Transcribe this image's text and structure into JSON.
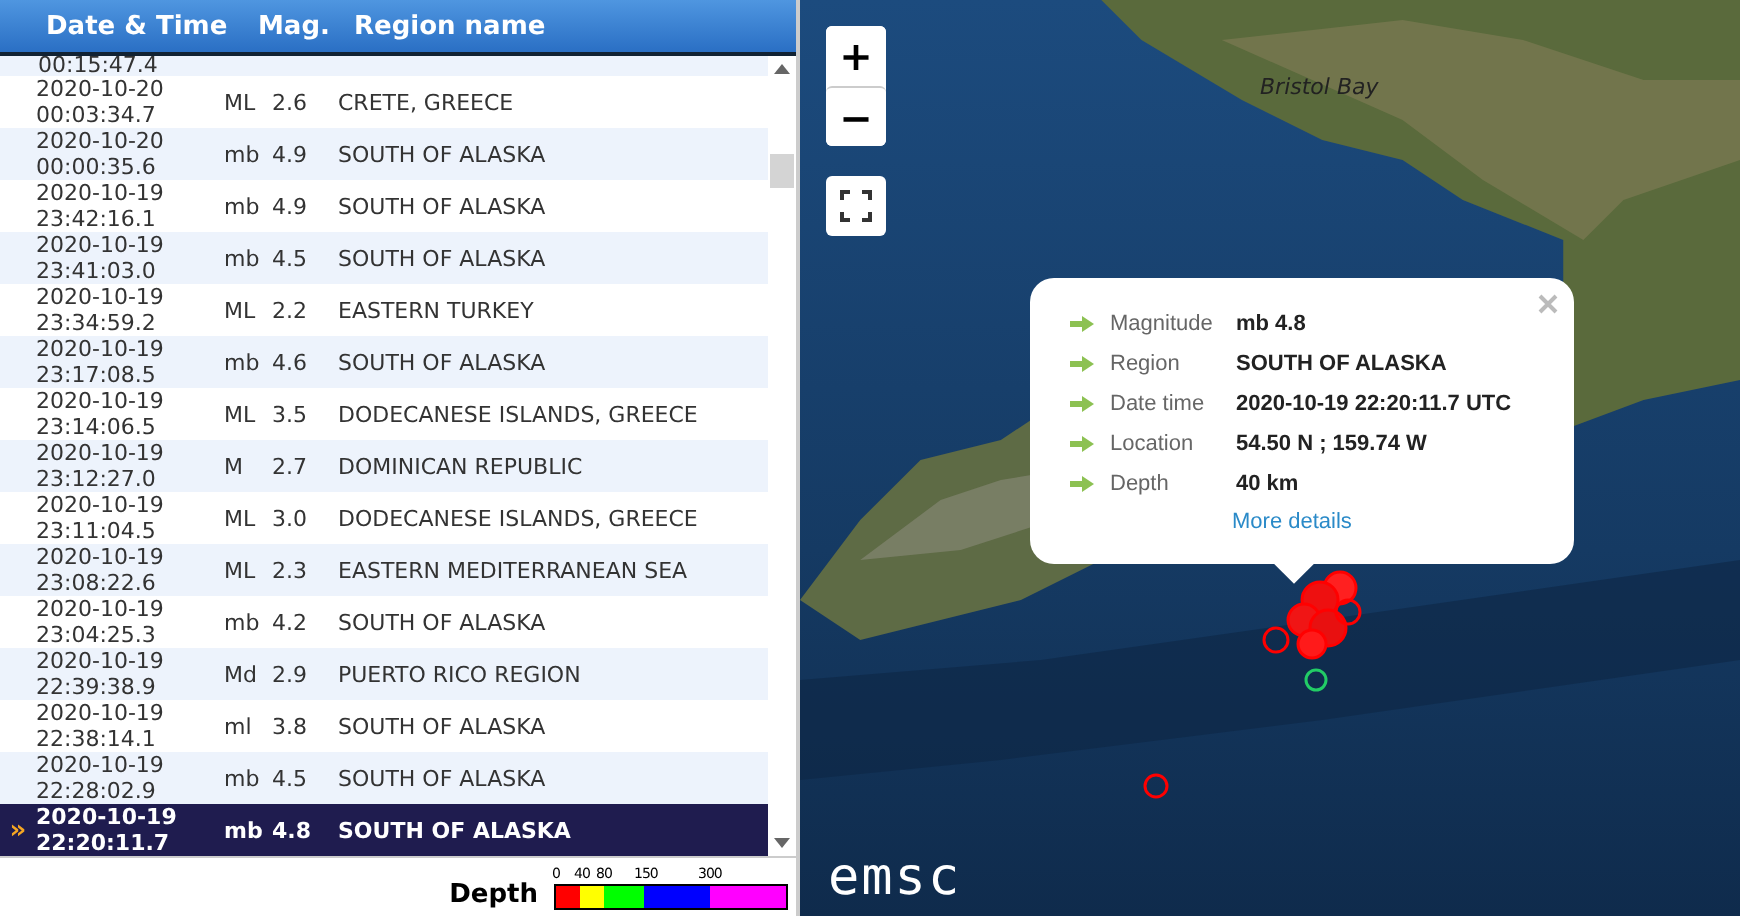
{
  "table": {
    "columns": [
      "Date & Time",
      "Mag.",
      "Region name"
    ],
    "partial_row": {
      "time": "00:15:47.4"
    },
    "rows": [
      {
        "date": "2020-10-20",
        "time": "00:03:34.7",
        "mag_type": "ML",
        "mag": "2.6",
        "region": "CRETE, GREECE",
        "selected": false
      },
      {
        "date": "2020-10-20",
        "time": "00:00:35.6",
        "mag_type": "mb",
        "mag": "4.9",
        "region": "SOUTH OF ALASKA",
        "selected": false
      },
      {
        "date": "2020-10-19",
        "time": "23:42:16.1",
        "mag_type": "mb",
        "mag": "4.9",
        "region": "SOUTH OF ALASKA",
        "selected": false
      },
      {
        "date": "2020-10-19",
        "time": "23:41:03.0",
        "mag_type": "mb",
        "mag": "4.5",
        "region": "SOUTH OF ALASKA",
        "selected": false
      },
      {
        "date": "2020-10-19",
        "time": "23:34:59.2",
        "mag_type": "ML",
        "mag": "2.2",
        "region": "EASTERN TURKEY",
        "selected": false
      },
      {
        "date": "2020-10-19",
        "time": "23:17:08.5",
        "mag_type": "mb",
        "mag": "4.6",
        "region": "SOUTH OF ALASKA",
        "selected": false
      },
      {
        "date": "2020-10-19",
        "time": "23:14:06.5",
        "mag_type": "ML",
        "mag": "3.5",
        "region": "DODECANESE ISLANDS, GREECE",
        "selected": false
      },
      {
        "date": "2020-10-19",
        "time": "23:12:27.0",
        "mag_type": "M",
        "mag": "2.7",
        "region": "DOMINICAN REPUBLIC",
        "selected": false
      },
      {
        "date": "2020-10-19",
        "time": "23:11:04.5",
        "mag_type": "ML",
        "mag": "3.0",
        "region": "DODECANESE ISLANDS, GREECE",
        "selected": false
      },
      {
        "date": "2020-10-19",
        "time": "23:08:22.6",
        "mag_type": "ML",
        "mag": "2.3",
        "region": "EASTERN MEDITERRANEAN SEA",
        "selected": false
      },
      {
        "date": "2020-10-19",
        "time": "23:04:25.3",
        "mag_type": "mb",
        "mag": "4.2",
        "region": "SOUTH OF ALASKA",
        "selected": false
      },
      {
        "date": "2020-10-19",
        "time": "22:39:38.9",
        "mag_type": "Md",
        "mag": "2.9",
        "region": "PUERTO RICO REGION",
        "selected": false
      },
      {
        "date": "2020-10-19",
        "time": "22:38:14.1",
        "mag_type": "ml",
        "mag": "3.8",
        "region": "SOUTH OF ALASKA",
        "selected": false
      },
      {
        "date": "2020-10-19",
        "time": "22:28:02.9",
        "mag_type": "mb",
        "mag": "4.5",
        "region": "SOUTH OF ALASKA",
        "selected": false
      },
      {
        "date": "2020-10-19",
        "time": "22:20:11.7",
        "mag_type": "mb",
        "mag": "4.8",
        "region": "SOUTH OF ALASKA",
        "selected": true
      }
    ],
    "selected_marker": "»"
  },
  "depth_legend": {
    "title": "Depth",
    "segments": [
      {
        "tick": "0",
        "color": "#ff0000"
      },
      {
        "tick": "40",
        "color": "#ffff00"
      },
      {
        "tick": "80",
        "color": "#00ff00"
      },
      {
        "tick": "150",
        "color": "#0000ff"
      },
      {
        "tick": "300",
        "color": "#ff00ff"
      }
    ]
  },
  "map": {
    "zoom_in": "+",
    "zoom_out": "−",
    "place_label": "Bristol Bay",
    "logo": "emsc",
    "popup": {
      "fields": [
        {
          "label": "Magnitude",
          "value": "mb 4.8"
        },
        {
          "label": "Region",
          "value": "SOUTH OF ALASKA"
        },
        {
          "label": "Date time",
          "value": "2020-10-19 22:20:11.7 UTC"
        },
        {
          "label": "Location",
          "value": "54.50 N ; 159.74 W"
        },
        {
          "label": "Depth",
          "value": "40 km"
        }
      ],
      "link": "More details"
    }
  }
}
